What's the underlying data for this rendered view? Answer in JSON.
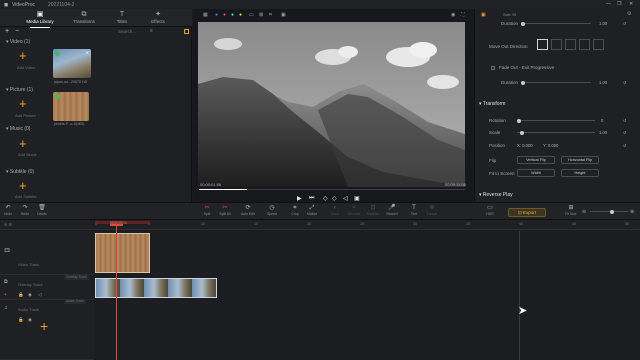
{
  "app": {
    "name": "VideoProc",
    "project": "20221104-2",
    "window_controls": [
      "—",
      "❐",
      "✕"
    ]
  },
  "library": {
    "tabs": [
      {
        "label": "Media Library",
        "icon": "media-library-icon",
        "glyph": "▣"
      },
      {
        "label": "Transitions",
        "icon": "transitions-icon",
        "glyph": "⧉"
      },
      {
        "label": "Titles",
        "icon": "titles-icon",
        "glyph": "T"
      },
      {
        "label": "Effects",
        "icon": "effects-icon",
        "glyph": "✦"
      }
    ],
    "search_placeholder": "Search...",
    "sections": [
      {
        "name": "Video",
        "count": "(1)",
        "add_label": "Add Video",
        "item_caption": "japan-au...29578 HD"
      },
      {
        "name": "Picture",
        "count": "(1)",
        "add_label": "Add Picture",
        "item_caption": "pexels-F...o-4(4K0)"
      },
      {
        "name": "Music",
        "count": "(0)",
        "add_label": "Add Music"
      },
      {
        "name": "Subtitle",
        "count": "(0)",
        "add_label": "Add Subtitle"
      }
    ]
  },
  "preview": {
    "timecode_left": "00:00:01.96",
    "timecode_right": "00:00:11.08",
    "timecode_total": "00:00:11.96",
    "progress_fraction": 0.18
  },
  "inspector": {
    "tab_label": "Sub: 5f",
    "duration_label": "Duration",
    "duration_value": "1.00",
    "move_out_label": "Move Out Direction",
    "fade_out_label": "Fade Out - Exit Progressive",
    "duration2_label": "Duration",
    "duration2_value": "1.00",
    "transform_header": "Transform",
    "rotation_label": "Rotation",
    "rotation_value": "0",
    "scale_label": "Scale",
    "scale_value": "1.00",
    "position_label": "Position",
    "position_x": "X: 0.000",
    "position_y": "Y: 0.000",
    "flip_label": "Flip",
    "vertical_flip": "Vertical Flip",
    "horizontal_flip": "Horizontal Flip",
    "fit_label": "Fit to Screen",
    "width_btn": "Width",
    "height_btn": "Height",
    "reverse_header": "Reverse Play"
  },
  "toolbar": {
    "left_tools": [
      {
        "label": "Undo",
        "icon": "undo-icon",
        "glyph": "↶"
      },
      {
        "label": "Redo",
        "icon": "redo-icon",
        "glyph": "↷"
      },
      {
        "label": "Delete",
        "icon": "trash-icon",
        "glyph": "🗑"
      }
    ],
    "edit_tools": [
      {
        "label": "Split",
        "icon": "split-icon",
        "glyph": "✂",
        "disabled": false
      },
      {
        "label": "Split All",
        "icon": "split-all-icon",
        "glyph": "✂",
        "disabled": false
      },
      {
        "label": "Auto Edit",
        "icon": "auto-edit-icon",
        "glyph": "⟳",
        "disabled": false
      },
      {
        "label": "Speed",
        "icon": "speed-icon",
        "glyph": "◷",
        "disabled": false
      },
      {
        "label": "Crop",
        "icon": "crop-icon",
        "glyph": "⌗",
        "disabled": false
      },
      {
        "label": "Motion",
        "icon": "motion-icon",
        "glyph": "⤢",
        "disabled": false
      },
      {
        "label": "Color",
        "icon": "color-icon",
        "glyph": "◐",
        "disabled": true
      },
      {
        "label": "Denoise",
        "icon": "denoise-icon",
        "glyph": "≈",
        "disabled": true
      },
      {
        "label": "Stabilize",
        "icon": "stabilize-icon",
        "glyph": "⊡",
        "disabled": true
      },
      {
        "label": "Record",
        "icon": "record-icon",
        "glyph": "🎤",
        "disabled": false
      },
      {
        "label": "Text",
        "icon": "text-icon",
        "glyph": "T",
        "disabled": false
      },
      {
        "label": "Freeze",
        "icon": "freeze-icon",
        "glyph": "❄",
        "disabled": true
      }
    ],
    "export_label": "Export",
    "fit_label": "Fit Size",
    "hdr_label": "HDR"
  },
  "timeline": {
    "playhead_time": "00:00:01.96",
    "ruler_ticks": [
      "0",
      "5",
      "10",
      "15",
      "20",
      "25",
      "30",
      "35",
      "40",
      "45",
      "50"
    ],
    "tracks": [
      {
        "name": "Video Track",
        "icon": "video-track-icon"
      },
      {
        "name": "Overlay Track",
        "icon": "overlay-track-icon"
      },
      {
        "name": "Audio Track",
        "icon": "audio-track-icon"
      }
    ],
    "mini_labels": [
      "Overlay Track",
      "Audio Track"
    ]
  },
  "colors": {
    "accent": "#f0a030",
    "playhead": "#e0483e",
    "background": "#1a1b1e"
  }
}
